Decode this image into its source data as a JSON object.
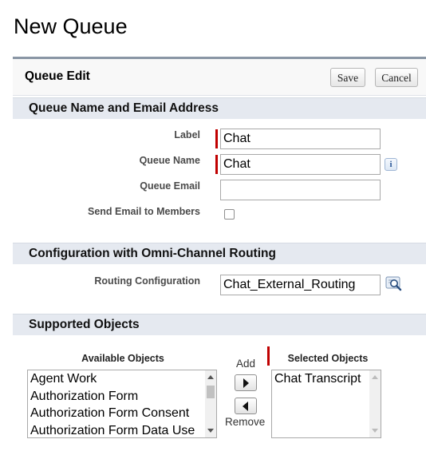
{
  "page": {
    "title": "New Queue"
  },
  "panel": {
    "title": "Queue Edit",
    "save_label": "Save",
    "cancel_label": "Cancel"
  },
  "sections": {
    "name_email": "Queue Name and Email Address",
    "omni": "Configuration with Omni-Channel Routing",
    "objects": "Supported Objects"
  },
  "fields": {
    "label": {
      "label": "Label",
      "value": "Chat"
    },
    "queue_name": {
      "label": "Queue Name",
      "value": "Chat"
    },
    "queue_email": {
      "label": "Queue Email",
      "value": ""
    },
    "send_email": {
      "label": "Send Email to Members",
      "checked": false
    },
    "routing": {
      "label": "Routing Configuration",
      "value": "Chat_External_Routing"
    }
  },
  "objects": {
    "available_heading": "Available Objects",
    "selected_heading": "Selected Objects",
    "add_label": "Add",
    "remove_label": "Remove",
    "available": [
      "Agent Work",
      "Authorization Form",
      "Authorization Form Consent",
      "Authorization Form Data Use"
    ],
    "selected": [
      "Chat Transcript"
    ]
  },
  "colors": {
    "required": "#c00000",
    "section_bg": "#e5e9f0",
    "panel_border": "#8a96a5"
  },
  "icons": {
    "info": "info-icon",
    "lookup": "lookup-icon"
  }
}
